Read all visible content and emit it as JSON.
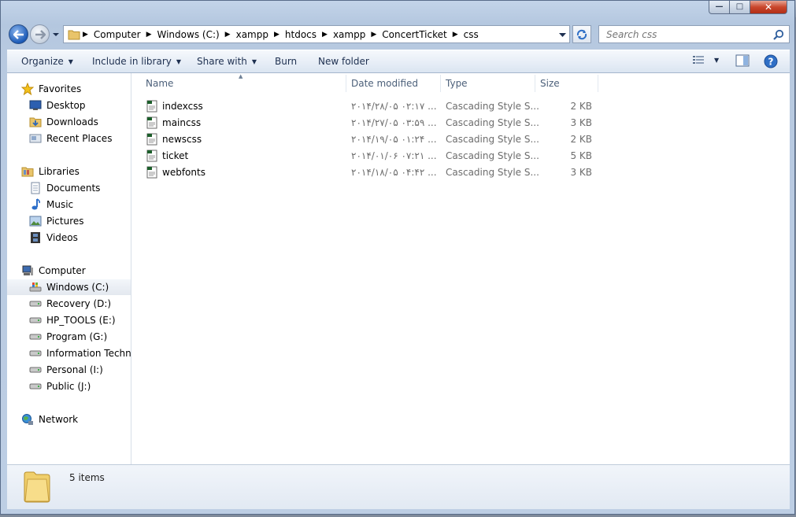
{
  "address": {
    "crumbs": [
      "Computer",
      "Windows (C:)",
      "xampp",
      "htdocs",
      "xampp",
      "ConcertTicket",
      "css"
    ]
  },
  "search": {
    "placeholder": "Search css"
  },
  "toolbar": {
    "organize": "Organize",
    "include_in_library": "Include in library",
    "share_with": "Share with",
    "burn": "Burn",
    "new_folder": "New folder"
  },
  "nav": {
    "favorites": "Favorites",
    "desktop": "Desktop",
    "downloads": "Downloads",
    "recent_places": "Recent Places",
    "libraries": "Libraries",
    "documents": "Documents",
    "music": "Music",
    "pictures": "Pictures",
    "videos": "Videos",
    "computer": "Computer",
    "drives": [
      "Windows (C:)",
      "Recovery (D:)",
      "HP_TOOLS (E:)",
      "Program (G:)",
      "Information Techno",
      "Personal (I:)",
      "Public (J:)"
    ],
    "network": "Network"
  },
  "columns": {
    "name": "Name",
    "date_modified": "Date modified",
    "type": "Type",
    "size": "Size"
  },
  "files": [
    {
      "name": "indexcss",
      "date": "۲۰۱۴/۲۸/۰۵ ۰۲:۱۷ ...",
      "type": "Cascading Style S...",
      "size": "2 KB"
    },
    {
      "name": "maincss",
      "date": "۲۰۱۴/۲۷/۰۵ ۰۳:۵۹ ...",
      "type": "Cascading Style S...",
      "size": "3 KB"
    },
    {
      "name": "newscss",
      "date": "۲۰۱۴/۱۹/۰۵ ۰۱:۲۴ ...",
      "type": "Cascading Style S...",
      "size": "2 KB"
    },
    {
      "name": "ticket",
      "date": "۲۰۱۴/۰۱/۰۶ ۰۷:۲۱ ...",
      "type": "Cascading Style S...",
      "size": "5 KB"
    },
    {
      "name": "webfonts",
      "date": "۲۰۱۴/۱۸/۰۵ ۰۴:۴۲ ...",
      "type": "Cascading Style S...",
      "size": "3 KB"
    }
  ],
  "details": {
    "item_count": "5 items"
  },
  "colors": {
    "accent": "#1c5bb8",
    "window_frame": "#b7c9e0",
    "selection": "#e3e8ef"
  }
}
